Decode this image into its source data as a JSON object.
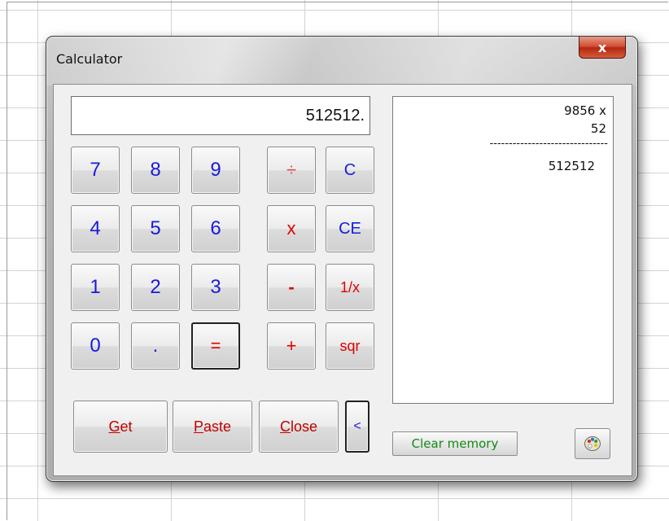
{
  "window": {
    "title": "Calculator",
    "close_label": "x"
  },
  "display": {
    "value": "512512."
  },
  "keys": {
    "seven": "7",
    "eight": "8",
    "nine": "9",
    "four": "4",
    "five": "5",
    "six": "6",
    "one": "1",
    "two": "2",
    "three": "3",
    "zero": "0",
    "dot": ".",
    "equals": "=",
    "divide": "÷",
    "multiply": "x",
    "minus": "-",
    "plus": "+",
    "clear": "C",
    "clear_entry": "CE",
    "reciprocal": "1/x",
    "sqr": "sqr"
  },
  "bottom_buttons": {
    "get": {
      "accel": "G",
      "rest": "et"
    },
    "paste": {
      "accel": "P",
      "rest": "aste"
    },
    "close": {
      "accel": "C",
      "rest": "lose"
    },
    "collapse": "<"
  },
  "tape": {
    "line1": "9856 x",
    "line2": "52",
    "separator": "-------------------------------",
    "result": "512512"
  },
  "memory": {
    "clear_label": "Clear memory"
  },
  "icons": {
    "close": "close-icon",
    "palette": "palette-icon"
  },
  "colors": {
    "digits": "#1a1adc",
    "operators": "#e00000",
    "clear_memory_text": "#138a13",
    "close_button": "#c8402a"
  }
}
